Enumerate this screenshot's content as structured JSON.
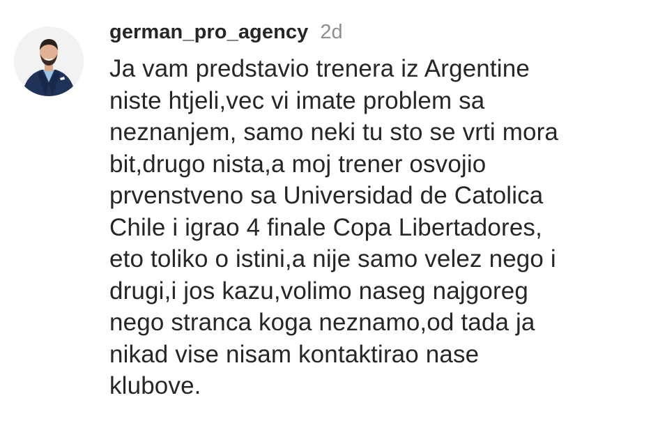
{
  "comment": {
    "avatar_icon": "profile-photo-man-in-suit",
    "username": "german_pro_agency",
    "timestamp": "2d",
    "text_lines": [
      "Ja vam predstavio trenera iz Argentine",
      "niste htjeli,vec vi imate problem sa",
      "neznanjem, samo neki tu sto se vrti mora",
      "bit,drugo nista,a moj trener osvojio",
      "prvenstveno sa Universidad de Catolica",
      "Chile i igrao 4 finale Copa Libertadores,",
      "eto toliko o istini,a nije samo velez nego i",
      "drugi,i jos kazu,volimo naseg najgoreg",
      "nego stranca koga neznamo,od tada ja",
      "nikad vise nisam kontaktirao nase",
      "klubove."
    ]
  },
  "colors": {
    "background": "#ffffff",
    "text_primary": "#262626",
    "text_secondary": "#8e8e8e",
    "suit": "#1f3257"
  }
}
